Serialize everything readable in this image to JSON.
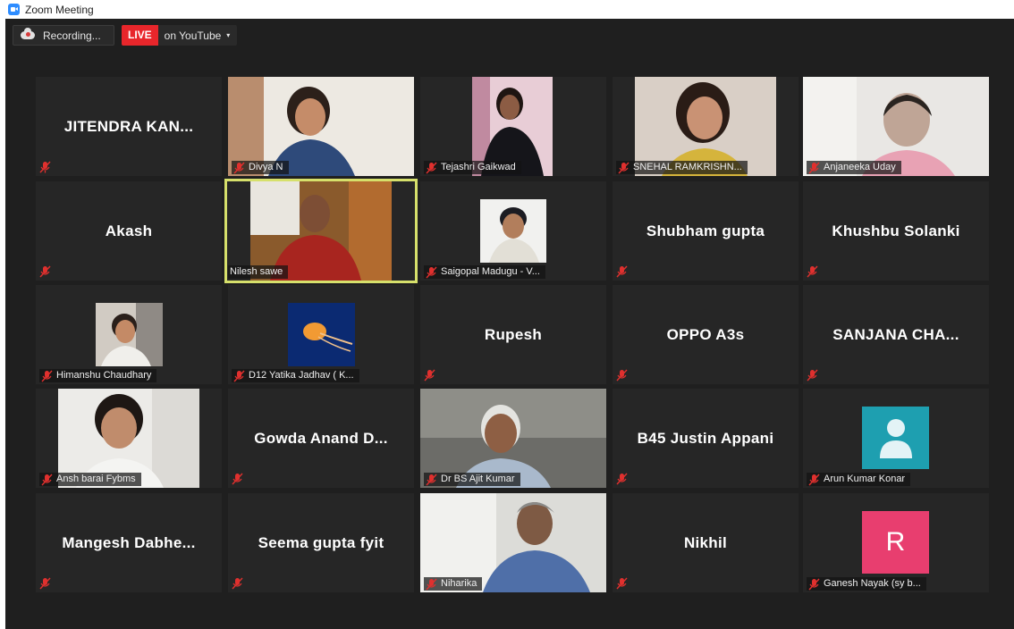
{
  "window": {
    "title": "Zoom Meeting"
  },
  "toolbar": {
    "recording_label": "Recording...",
    "live_badge": "LIVE",
    "live_target": "on YouTube",
    "caret": "▾"
  },
  "colors": {
    "active_speaker_border": "#d6e06b",
    "live_red": "#e8262b",
    "mute_red": "#e0302e",
    "arun_avatar": "#1e9fb0",
    "ganesh_avatar": "#e83e6f"
  },
  "tiles": [
    {
      "display": "JITENDRA  KAN...",
      "label": ""
    },
    {
      "display": "",
      "label": "Divya N"
    },
    {
      "display": "",
      "label": "Tejashri Gaikwad"
    },
    {
      "display": "",
      "label": "SNEHAL RAMKRISHN..."
    },
    {
      "display": "",
      "label": "Anjaneeka Uday"
    },
    {
      "display": "Akash",
      "label": ""
    },
    {
      "display": "",
      "label": "Nilesh sawe"
    },
    {
      "display": "",
      "label": "Saigopal Madugu - V..."
    },
    {
      "display": "Shubham gupta",
      "label": ""
    },
    {
      "display": "Khushbu Solanki",
      "label": ""
    },
    {
      "display": "",
      "label": "Himanshu Chaudhary"
    },
    {
      "display": "",
      "label": "D12 Yatika Jadhav ( K..."
    },
    {
      "display": "Rupesh",
      "label": ""
    },
    {
      "display": "OPPO A3s",
      "label": ""
    },
    {
      "display": "SANJANA  CHA...",
      "label": ""
    },
    {
      "display": "",
      "label": "Ansh barai Fybms"
    },
    {
      "display": "Gowda Anand D...",
      "label": ""
    },
    {
      "display": "",
      "label": "Dr BS Ajit Kumar"
    },
    {
      "display": "B45 Justin Appani",
      "label": ""
    },
    {
      "display": "",
      "label": "Arun Kumar Konar"
    },
    {
      "display": "Mangesh  Dabhe...",
      "label": ""
    },
    {
      "display": "Seema gupta fyit",
      "label": ""
    },
    {
      "display": "",
      "label": "Niharika"
    },
    {
      "display": "Nikhil",
      "label": ""
    },
    {
      "display": "",
      "label": "Ganesh Nayak  (sy b..."
    }
  ],
  "avatars": {
    "ganesh_initial": "R"
  }
}
